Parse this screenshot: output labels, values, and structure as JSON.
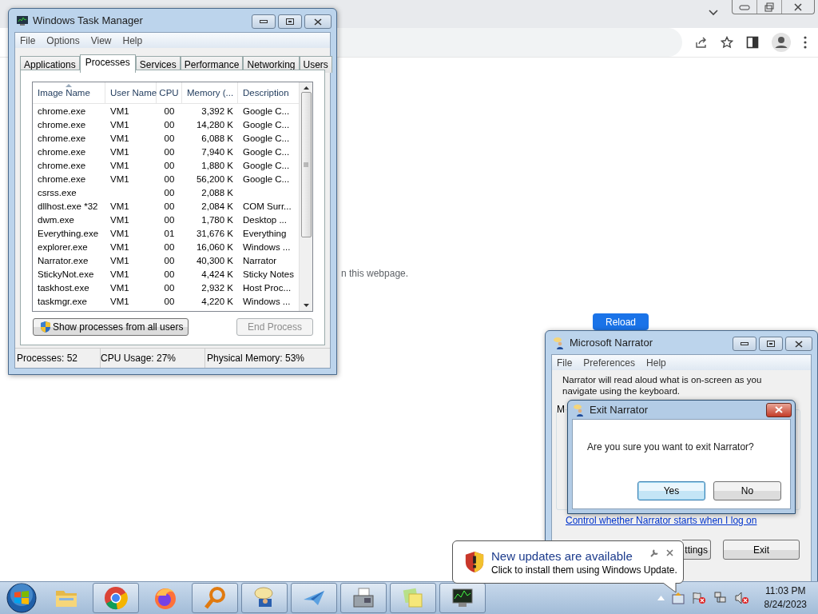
{
  "browser": {
    "page_text": "n this webpage.",
    "reload_button": "Reload"
  },
  "task_manager": {
    "title": "Windows Task Manager",
    "menu": [
      "File",
      "Options",
      "View",
      "Help"
    ],
    "tabs": [
      {
        "label": "Applications",
        "selected": false
      },
      {
        "label": "Processes",
        "selected": true
      },
      {
        "label": "Services",
        "selected": false
      },
      {
        "label": "Performance",
        "selected": false
      },
      {
        "label": "Networking",
        "selected": false
      },
      {
        "label": "Users",
        "selected": false
      }
    ],
    "columns": [
      {
        "label": "Image Name",
        "sorted": true
      },
      {
        "label": "User Name",
        "sorted": false
      },
      {
        "label": "CPU",
        "sorted": false
      },
      {
        "label": "Memory (...",
        "sorted": false
      },
      {
        "label": "Description",
        "sorted": false
      }
    ],
    "rows": [
      {
        "image": "chrome.exe",
        "user": "VM1",
        "cpu": "00",
        "memory": "3,392 K",
        "description": "Google C..."
      },
      {
        "image": "chrome.exe",
        "user": "VM1",
        "cpu": "00",
        "memory": "14,280 K",
        "description": "Google C..."
      },
      {
        "image": "chrome.exe",
        "user": "VM1",
        "cpu": "00",
        "memory": "6,088 K",
        "description": "Google C..."
      },
      {
        "image": "chrome.exe",
        "user": "VM1",
        "cpu": "00",
        "memory": "7,940 K",
        "description": "Google C..."
      },
      {
        "image": "chrome.exe",
        "user": "VM1",
        "cpu": "00",
        "memory": "1,880 K",
        "description": "Google C..."
      },
      {
        "image": "chrome.exe",
        "user": "VM1",
        "cpu": "00",
        "memory": "56,200 K",
        "description": "Google C..."
      },
      {
        "image": "csrss.exe",
        "cpu": "00",
        "memory": "2,088 K"
      },
      {
        "image": "dllhost.exe *32",
        "user": "VM1",
        "cpu": "00",
        "memory": "2,084 K",
        "description": "COM Surr..."
      },
      {
        "image": "dwm.exe",
        "user": "VM1",
        "cpu": "00",
        "memory": "1,780 K",
        "description": "Desktop ..."
      },
      {
        "image": "Everything.exe",
        "user": "VM1",
        "cpu": "01",
        "memory": "31,676 K",
        "description": "Everything"
      },
      {
        "image": "explorer.exe",
        "user": "VM1",
        "cpu": "00",
        "memory": "16,060 K",
        "description": "Windows ..."
      },
      {
        "image": "Narrator.exe",
        "user": "VM1",
        "cpu": "00",
        "memory": "40,300 K",
        "description": "Narrator"
      },
      {
        "image": "StickyNot.exe",
        "user": "VM1",
        "cpu": "00",
        "memory": "4,424 K",
        "description": "Sticky Notes"
      },
      {
        "image": "taskhost.exe",
        "user": "VM1",
        "cpu": "00",
        "memory": "2,932 K",
        "description": "Host Proc..."
      },
      {
        "image": "taskmgr.exe",
        "user": "VM1",
        "cpu": "00",
        "memory": "4,220 K",
        "description": "Windows ..."
      }
    ],
    "show_all_button": "Show processes from all users",
    "end_process_button": {
      "label": "End Process",
      "disabled": true
    },
    "status_bar": [
      "Processes: 52",
      "CPU Usage: 27%",
      "Physical Memory: 53%"
    ]
  },
  "narrator": {
    "title": "Microsoft Narrator",
    "menu": [
      "File",
      "Preferences",
      "Help"
    ],
    "description": "Narrator will read aloud what is on-screen as you navigate using the keyboard.",
    "group_label": "M",
    "link": "Control whether Narrator starts when I log on",
    "buttons": [
      {
        "label": "ttings"
      },
      {
        "label": "Exit"
      }
    ]
  },
  "exit_dialog": {
    "title": "Exit Narrator",
    "message": "Are you sure you want to exit Narrator?",
    "buttons": [
      {
        "label": "Yes",
        "default": true
      },
      {
        "label": "No",
        "default": false
      }
    ]
  },
  "notification": {
    "title": "New updates are available",
    "message": "Click to install them using Windows Update."
  },
  "taskbar": {
    "apps": [
      {
        "kind": "explorer",
        "running": false
      },
      {
        "kind": "chrome",
        "running": true
      },
      {
        "kind": "firefox",
        "running": false
      },
      {
        "kind": "magnifier",
        "running": true
      },
      {
        "kind": "narrator",
        "running": true
      },
      {
        "kind": "plane",
        "running": true
      },
      {
        "kind": "fax",
        "running": true
      },
      {
        "kind": "sticky",
        "running": true
      },
      {
        "kind": "taskmgr",
        "running": true
      }
    ],
    "clock": {
      "time": "11:03 PM",
      "date": "8/24/2023"
    }
  }
}
